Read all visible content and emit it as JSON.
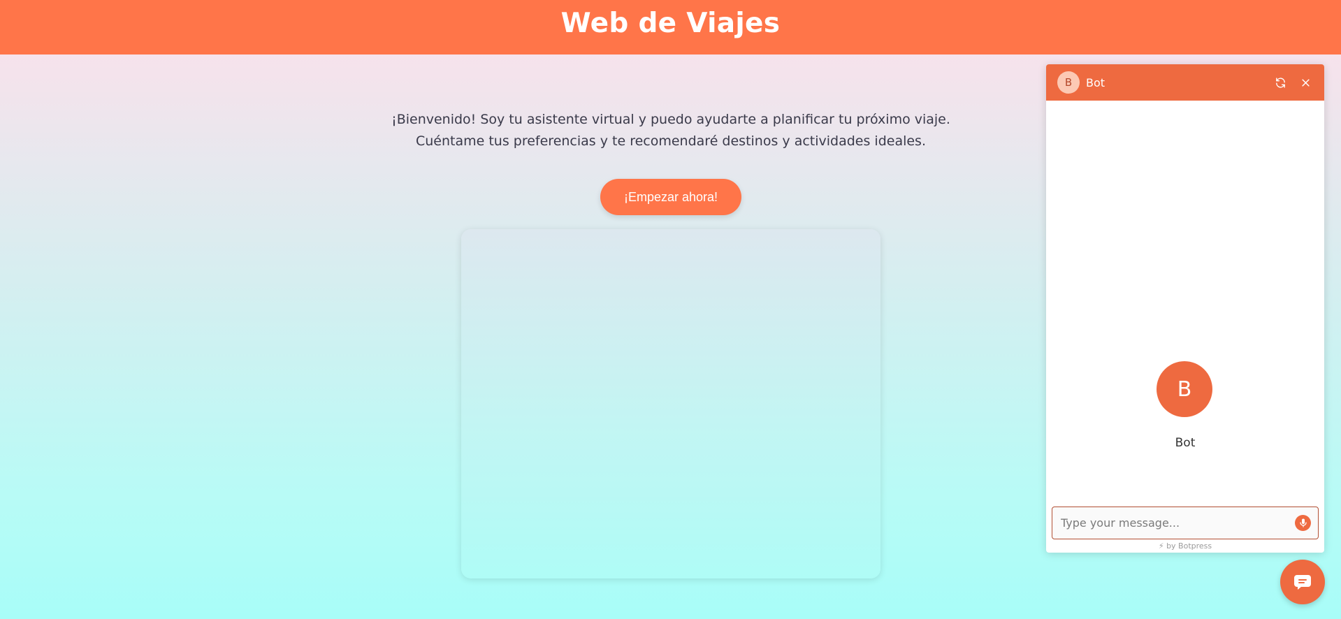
{
  "header": {
    "title": "Web de Viajes"
  },
  "intro": {
    "line1": "¡Bienvenido! Soy tu asistente virtual y puedo ayudarte a planificar tu próximo viaje.",
    "line2": "Cuéntame tus preferencias y te recomendaré destinos y actividades ideales."
  },
  "cta": {
    "label": "¡Empezar ahora!"
  },
  "chat": {
    "header": {
      "avatar_initial": "B",
      "bot_name": "Bot",
      "icons": [
        "refresh-icon",
        "close-icon"
      ]
    },
    "body": {
      "avatar_initial": "B",
      "bot_name": "Bot"
    },
    "composer": {
      "placeholder": "Type your message...",
      "value": ""
    },
    "powered_by": "⚡ by Botpress"
  },
  "colors": {
    "accent": "#ff7549",
    "chat_accent": "#ee6a40"
  }
}
